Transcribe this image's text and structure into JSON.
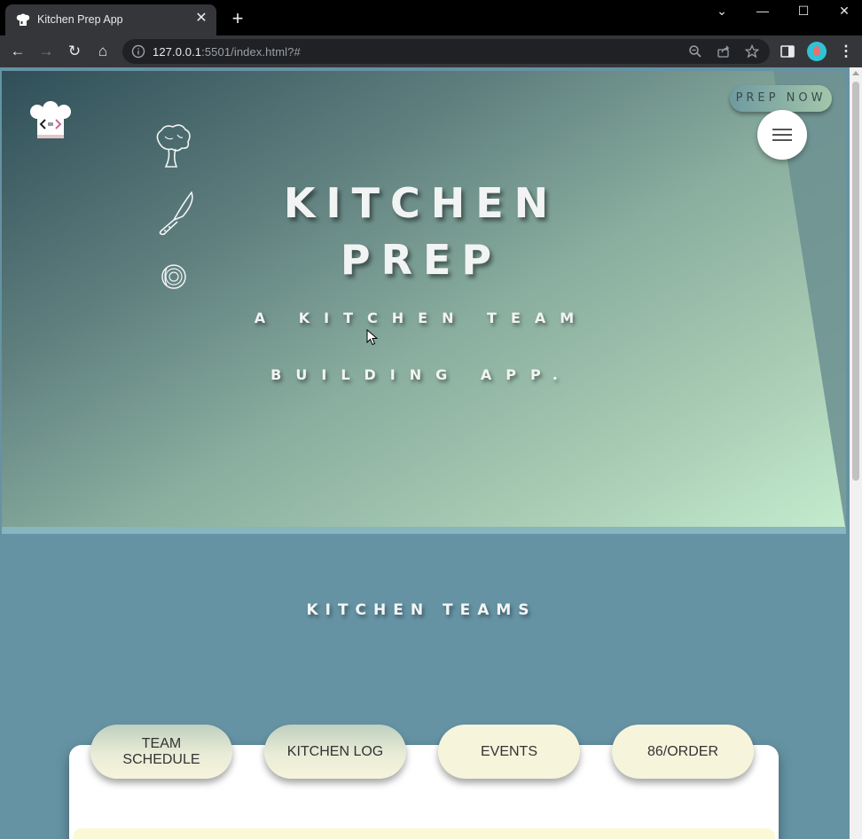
{
  "browser": {
    "tab_title": "Kitchen Prep App",
    "tab_close": "✕",
    "new_tab": "+",
    "url_host": "127.0.0.1",
    "url_rest": ":5501/index.html?#",
    "controls": {
      "collapse": "⌄",
      "minimize": "—",
      "maximize": "☐",
      "close": "✕"
    },
    "nav": {
      "back": "←",
      "forward": "→",
      "reload": "↻",
      "home": "⌂",
      "menu": "⋮"
    }
  },
  "hero": {
    "title_line1": "KITCHEN",
    "title_line2": "PREP",
    "subtitle_line1": "A KITCHEN TEAM",
    "subtitle_line2": "BUILDING APP.",
    "cta_label": "PREP NOW",
    "side_icons": [
      "broccoli-icon",
      "knife-icon",
      "onion-icon"
    ]
  },
  "teams": {
    "title": "KITCHEN TEAMS",
    "tabs": [
      {
        "label": "TEAM SCHEDULE"
      },
      {
        "label": "KITCHEN LOG"
      },
      {
        "label": "EVENTS"
      },
      {
        "label": "86/ORDER"
      }
    ]
  },
  "colors": {
    "page_bg": "#6593a4",
    "hero_gradient_start": "#2f4e58",
    "hero_gradient_end": "#c5eccf",
    "pill_bg": "#f7f4dc"
  }
}
